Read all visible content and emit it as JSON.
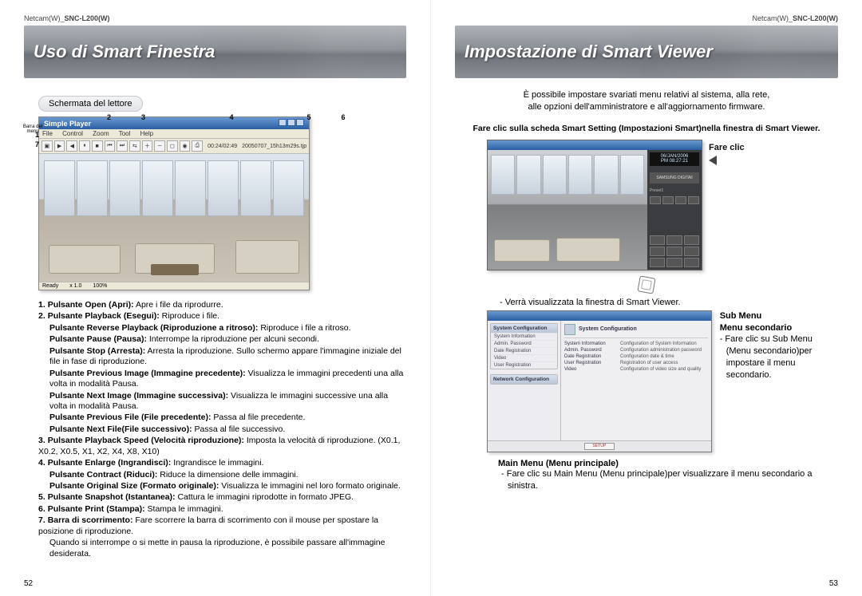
{
  "left": {
    "header_prefix": "Netcam(W)_",
    "header_model": "SNC-L200(W)",
    "banner": "Uso di Smart Finestra",
    "sub_label": "Schermata del lettore",
    "callouts_top": "2  3       4      5  6",
    "callouts_side_1": "1",
    "callouts_side_7": "7",
    "barra": "Barra del menu",
    "player": {
      "title": "Simple Player",
      "menu": {
        "file": "File",
        "control": "Control",
        "zoom": "Zoom",
        "tool": "Tool",
        "help": "Help"
      },
      "time": "00:24/02:49",
      "filename": "20050707_15h13m29s.tjp",
      "status_ready": "Ready",
      "status_zoom": "x 1.0",
      "status_pct": "100%"
    },
    "items": [
      {
        "n": "1.",
        "t": "Pulsante Open (Apri):",
        "d": " Apre i file da riprodurre."
      },
      {
        "n": "2.",
        "t": "Pulsante Playback (Esegui):",
        "d": " Riproduce i file."
      },
      {
        "n": "",
        "t": "Pulsante Reverse Playback (Riproduzione a ritroso):",
        "d": " Riproduce i file a ritroso."
      },
      {
        "n": "",
        "t": "Pulsante Pause (Pausa):",
        "d": " Interrompe la riproduzione per alcuni secondi."
      },
      {
        "n": "",
        "t": "Pulsante Stop (Arresta):",
        "d": " Arresta la riproduzione. Sullo schermo appare l'immagine iniziale del file in fase di riproduzione."
      },
      {
        "n": "",
        "t": "Pulsante Previous Image (Immagine precedente):",
        "d": " Visualizza le immagini precedenti una alla volta in modalità Pausa."
      },
      {
        "n": "",
        "t": "Pulsante Next Image (Immagine successiva):",
        "d": " Visualizza le immagini successive una alla volta in modalità Pausa."
      },
      {
        "n": "",
        "t": "Pulsante Previous File (File precedente):",
        "d": " Passa al file precedente."
      },
      {
        "n": "",
        "t": "Pulsante Next File(File successivo):",
        "d": " Passa al file successivo."
      },
      {
        "n": "3.",
        "t": "Pulsante Playback Speed (Velocità riproduzione):",
        "d": " Imposta la velocità di riproduzione. (X0.1, X0.2, X0.5, X1, X2, X4, X8, X10)"
      },
      {
        "n": "4.",
        "t": "Pulsante Enlarge (Ingrandisci):",
        "d": " Ingrandisce le immagini."
      },
      {
        "n": "",
        "t": "Pulsante Contract (Riduci):",
        "d": " Riduce la dimensione delle immagini."
      },
      {
        "n": "",
        "t": "Pulsante Original Size (Formato originale):",
        "d": " Visualizza le immagini nel loro formato originale."
      },
      {
        "n": "5.",
        "t": "Pulsante Snapshot (Istantanea):",
        "d": " Cattura le immagini riprodotte in formato JPEG."
      },
      {
        "n": "6.",
        "t": "Pulsante Print (Stampa):",
        "d": " Stampa le immagini."
      },
      {
        "n": "7.",
        "t": "Barra di scorrimento:",
        "d": " Fare scorrere la barra di scorrimento con il mouse per spostare la posizione di riproduzione."
      },
      {
        "n": "",
        "t": "",
        "d": "Quando si interrompe o si mette in pausa la riproduzione, è possibile passare all'immagine desiderata."
      }
    ],
    "pageno": "52"
  },
  "right": {
    "header_prefix": "Netcam(W)_",
    "header_model": "SNC-L200(W)",
    "banner": "Impostazione di Smart Viewer",
    "intro1": "È possibile impostare svariati menu relativi al sistema, alla rete,",
    "intro2": "alle opzioni dell'amministratore e all'aggiornamento firmware.",
    "instr": "Fare clic sulla scheda Smart Setting (Impostazioni Smart)nella finestra di Smart Viewer.",
    "fare_clic": "Fare clic",
    "viewer": {
      "date": "06/JAN/2006",
      "time": "PM 08:27:21",
      "brand": "SAMSUNG DIGITAll",
      "preset": "Preset1"
    },
    "after_viewer": "- Verrà visualizzata la finestra di Smart Viewer.",
    "config": {
      "side_group1": "System Configuration",
      "side_items1": [
        "System Information",
        "Admin. Password",
        "Date Registration",
        "Video",
        "User Registration"
      ],
      "side_group2": "Network Configuration",
      "main_title": "System Configuration",
      "rows": [
        {
          "k": "System Information",
          "v": "Configuration of System Information"
        },
        {
          "k": "Admin. Password",
          "v": "Configuration administration password"
        },
        {
          "k": "Date Registration",
          "v": "Configuration date & time"
        },
        {
          "k": "User Registration",
          "v": "Registration of user access"
        },
        {
          "k": "Video",
          "v": "Configuration of video size and quality"
        }
      ],
      "foot": "SETUP"
    },
    "submenu_hd1": "Sub Menu",
    "submenu_hd2": "Menu secondario",
    "submenu_li": "- Fare clic su Sub Menu (Menu secondario)per impostare il menu secondario.",
    "mainmenu_hd": "Main Menu (Menu principale)",
    "mainmenu_li": "- Fare clic su Main Menu (Menu principale)per visualizzare il menu secondario a sinistra.",
    "pageno": "53"
  }
}
